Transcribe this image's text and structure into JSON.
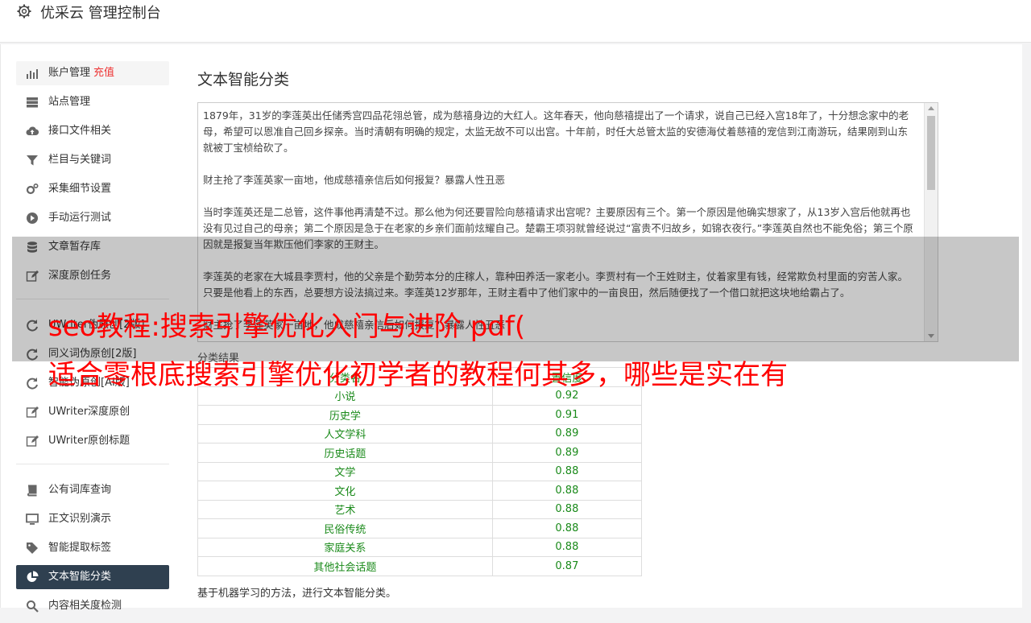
{
  "app": {
    "title": "优采云 管理控制台",
    "icon": "gear-icon"
  },
  "sidebar": {
    "group1": [
      {
        "label": "账户管理",
        "extra": "充值",
        "icon": "bar-chart-icon"
      },
      {
        "label": "站点管理",
        "icon": "server-icon"
      },
      {
        "label": "接口文件相关",
        "icon": "cloud-upload-icon"
      },
      {
        "label": "栏目与关键词",
        "icon": "filter-icon"
      },
      {
        "label": "采集细节设置",
        "icon": "cogs-icon"
      },
      {
        "label": "手动运行测试",
        "icon": "play-circle-icon"
      },
      {
        "label": "文章暂存库",
        "icon": "database-icon"
      },
      {
        "label": "深度原创任务",
        "icon": "edit-icon"
      }
    ],
    "group2": [
      {
        "label": "UWriter伪原创[2版]",
        "icon": "refresh-icon"
      },
      {
        "label": "同义词伪原创[2版]",
        "icon": "refresh-icon"
      },
      {
        "label": "智能伪原创[AI版]",
        "icon": "refresh-icon"
      },
      {
        "label": "UWriter深度原创",
        "icon": "edit-icon"
      },
      {
        "label": "UWriter原创标题",
        "icon": "edit-icon"
      }
    ],
    "group3": [
      {
        "label": "公有词库查询",
        "icon": "book-icon"
      },
      {
        "label": "正文识别演示",
        "icon": "monitor-icon"
      },
      {
        "label": "智能提取标签",
        "icon": "tag-icon"
      },
      {
        "label": "文本智能分类",
        "icon": "pie-chart-icon"
      },
      {
        "label": "内容相关度检测",
        "icon": "search-icon"
      }
    ]
  },
  "main": {
    "title": "文本智能分类",
    "paragraphs": [
      "1879年，31岁的李莲英出任储秀宫四品花翎总管，成为慈禧身边的大红人。这年春天，他向慈禧提出了一个请求，说自己已经入宫18年了，十分想念家中的老母，希望可以恩准自己回乡探亲。当时清朝有明确的规定，太监无故不可以出宫。十年前，时任大总管太监的安德海仗着慈禧的宠信到江南游玩，结果刚到山东就被丁宝桢给砍了。",
      "财主抢了李莲英家一亩地，他成慈禧亲信后如何报复？暴露人性丑恶",
      "当时李莲英还是二总管，这件事他再清楚不过。那么他为何还要冒险向慈禧请求出宫呢？主要原因有三个。第一个原因是他确实想家了，从13岁入宫后他就再也没有见过自己的母亲；第二个原因是急于在老家的乡亲们面前炫耀自己。楚霸王项羽就曾经说过“富贵不归故乡，如锦衣夜行。”李莲英自然也不能免俗；第三个原因就是报复当年欺压他们李家的王财主。",
      "李莲英的老家在大城县李贾村，他的父亲是个勤劳本分的庄稼人，靠种田养活一家老小。李贾村有一个王姓财主，仗着家里有钱，经常欺负村里面的穷苦人家。只要是他看上的东西，总要想方设法搞过来。李莲英12岁那年，王财主看中了他们家中的一亩良田，然后随便找了一个借口就把这块地给霸占了。",
      "财主抢了李莲英家一亩地，他成慈禧亲信后如何报复？暴露人性丑恶"
    ],
    "result_label": "分类结果",
    "table": {
      "headers": [
        "分类名",
        "置信度"
      ],
      "rows": [
        [
          "小说",
          "0.92"
        ],
        [
          "历史学",
          "0.91"
        ],
        [
          "人文学科",
          "0.89"
        ],
        [
          "历史话题",
          "0.89"
        ],
        [
          "文学",
          "0.88"
        ],
        [
          "文化",
          "0.88"
        ],
        [
          "艺术",
          "0.88"
        ],
        [
          "民俗传统",
          "0.88"
        ],
        [
          "家庭关系",
          "0.88"
        ],
        [
          "其他社会话题",
          "0.87"
        ]
      ]
    },
    "footnote": "基于机器学习的方法，进行文本智能分类。"
  },
  "overlay": {
    "line1": "seo教程:搜索引擎优化入门与进阶 pdf(",
    "line2": "适合零根底搜索引擎优化初学者的教程何其多，哪些是实在有"
  },
  "colors": {
    "active_bg": "#2f4050",
    "recharge": "#ee3333",
    "table_text": "#1a8a1a",
    "overlay_text": "#ff0000"
  }
}
